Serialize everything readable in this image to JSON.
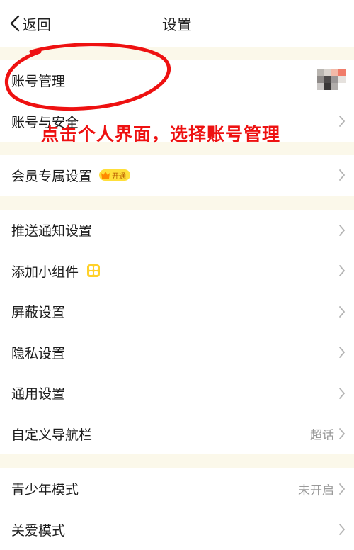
{
  "header": {
    "back_label": "返回",
    "title": "设置"
  },
  "group1": {
    "account_management": "账号管理",
    "account_security": "账号与安全",
    "member_settings": "会员专属设置",
    "vip_badge": "开通"
  },
  "group2": {
    "push": "推送通知设置",
    "add_widget": "添加小组件",
    "block": "屏蔽设置",
    "privacy": "隐私设置",
    "general": "通用设置",
    "custom_nav": "自定义导航栏",
    "custom_nav_value": "超话"
  },
  "group3": {
    "teen_mode": "青少年模式",
    "teen_mode_value": "未开启",
    "care_mode": "关爱模式"
  },
  "annotation": {
    "text": "点击个人界面，选择账号管理"
  },
  "colors": {
    "annotation": "#ee1111",
    "accent": "#ffd12a",
    "background": "#fbf8ea"
  }
}
